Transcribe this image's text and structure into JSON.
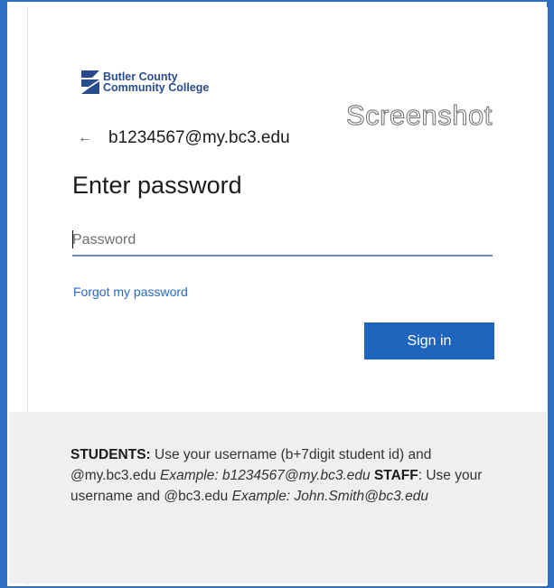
{
  "brand": {
    "logo_line1": "Butler County",
    "logo_line2": "Community College",
    "logo_color": "#2b4c8c"
  },
  "watermark": "Screenshot",
  "identity": {
    "back_icon": "back-arrow-icon",
    "email": "b1234567@my.bc3.edu"
  },
  "title": "Enter password",
  "password": {
    "placeholder": "Password",
    "value": ""
  },
  "forgot_link": "Forgot my password",
  "signin_label": "Sign in",
  "footer": {
    "students_label": "STUDENTS:",
    "students_text": " Use your username (b+7digit student id) and @my.bc3.edu ",
    "students_example": "Example: b1234567@my.bc3.edu",
    "staff_label": "STAFF",
    "staff_text": ": Use your username and @bc3.edu ",
    "staff_example": "Example: John.Smith@bc3.edu"
  },
  "colors": {
    "frame": "#2f6fc1",
    "accent": "#1f65bd",
    "link": "#2869c8",
    "footer_bg": "#efefef"
  }
}
